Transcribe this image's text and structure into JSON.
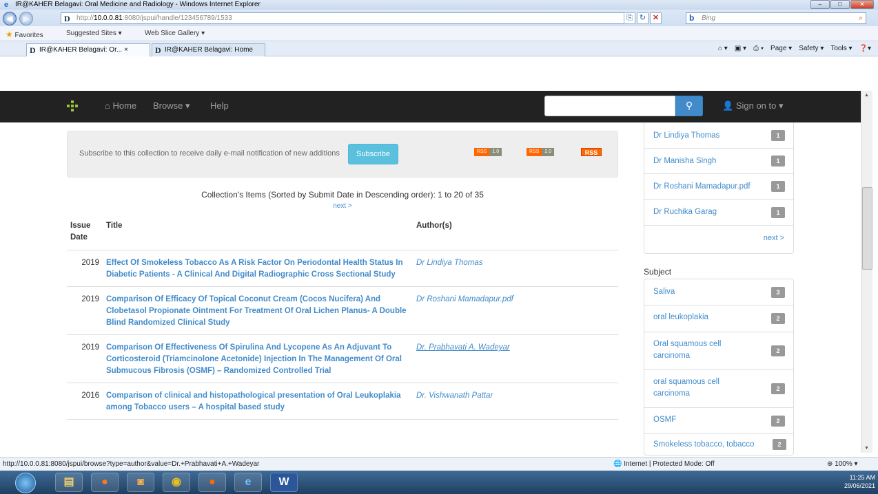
{
  "browser": {
    "window_title": "IR@KAHER Belagavi: Oral Medicine and Radiology - Windows Internet Explorer",
    "url_prefix": "http://",
    "url_host": "10.0.0.81",
    "url_rest": ":8080/jspui/handle/123456789/1533",
    "search_placeholder": "Bing",
    "favorites_label": "Favorites",
    "suggested_sites": "Suggested Sites ▾",
    "web_slice_gallery": "Web Slice Gallery ▾",
    "tabs": [
      {
        "label": "IR@KAHER Belagavi: Or... ×"
      },
      {
        "label": "IR@KAHER Belagavi: Home"
      }
    ],
    "command_bar": [
      "Page ▾",
      "Safety ▾",
      "Tools ▾"
    ],
    "status_url": "http://10.0.0.81:8080/jspui/browse?type=author&value=Dr.+Prabhavati+A.+Wadeyar",
    "status_zone": "Internet | Protected Mode: Off",
    "status_zoom": "100%"
  },
  "nav": {
    "home": "Home",
    "browse": "Browse ▾",
    "help": "Help",
    "sign_on": "Sign on to ▾",
    "search_icon": "search-icon"
  },
  "subscribe": {
    "text": "Subscribe to this collection to receive daily e-mail notification of new additions",
    "button": "Subscribe",
    "rss1_a": "RSS",
    "rss1_b": "1.0",
    "rss2_a": "RSS",
    "rss2_b": "2.0",
    "rss_big": "RSS"
  },
  "collection": {
    "heading": "Collection's Items (Sorted by Submit Date in Descending order): 1 to 20 of 35",
    "next": "next >",
    "columns": {
      "issue_date": "Issue Date",
      "title": "Title",
      "authors": "Author(s)"
    },
    "rows": [
      {
        "date": "2019",
        "title": "Effect Of Smokeless Tobacco As A Risk Factor On Periodontal Health Status In Diabetic Patients - A Clinical And Digital Radiographic Cross Sectional Study",
        "author": "Dr Lindiya Thomas"
      },
      {
        "date": "2019",
        "title": "Comparison Of Efficacy Of Topical Coconut Cream (Cocos Nucifera) And Clobetasol Propionate Ointment For Treatment Of Oral Lichen Planus- A Double Blind Randomized Clinical Study",
        "author": "Dr Roshani Mamadapur.pdf"
      },
      {
        "date": "2019",
        "title": "Comparison Of Effectiveness Of Spirulina And Lycopene As An Adjuvant To Corticosteroid (Triamcinolone Acetonide) Injection In The Management Of Oral Submucous Fibrosis (OSMF) – Randomized Controlled Trial",
        "author": "Dr. Prabhavati A. Wadeyar"
      },
      {
        "date": "2016",
        "title": "Comparison of clinical and histopathological presentation of Oral Leukoplakia among Tobacco users – A hospital based study",
        "author": "Dr. Vishwanath Pattar"
      }
    ]
  },
  "sidebar": {
    "authors": [
      {
        "name": "Dr Lindiya Thomas",
        "count": "1"
      },
      {
        "name": "Dr Manisha Singh",
        "count": "1"
      },
      {
        "name": "Dr Roshani Mamadapur.pdf",
        "count": "1"
      },
      {
        "name": "Dr Ruchika Garag",
        "count": "1"
      }
    ],
    "authors_next": "next >",
    "subject_heading": "Subject",
    "subjects": [
      {
        "name": "Saliva",
        "count": "3"
      },
      {
        "name": "oral leukoplakia",
        "count": "2"
      },
      {
        "name": "Oral squamous cell carcinoma",
        "count": "2"
      },
      {
        "name": "oral squamous cell carcinoma",
        "count": "2"
      },
      {
        "name": "OSMF",
        "count": "2"
      },
      {
        "name": "Smokeless tobacco, tobacco",
        "count": "2"
      }
    ]
  },
  "taskbar": {
    "time": "11:25 AM",
    "date": "29/06/2021"
  }
}
